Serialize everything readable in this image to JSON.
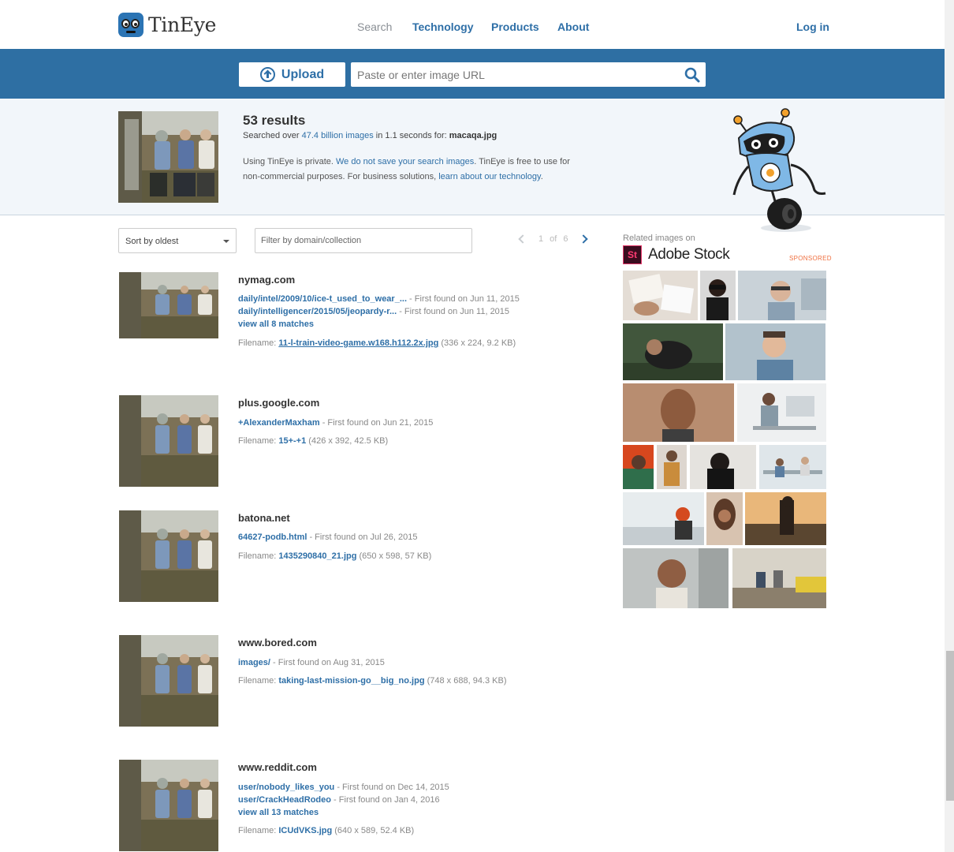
{
  "header": {
    "logo_text": "TinEye",
    "nav": {
      "search": "Search",
      "technology": "Technology",
      "products": "Products",
      "about": "About"
    },
    "login": "Log in"
  },
  "searchbar": {
    "upload_label": "Upload",
    "url_placeholder": "Paste or enter image URL"
  },
  "summary": {
    "results_count": "53 results",
    "searched_prefix": "Searched over ",
    "searched_link": "47.4 billion images",
    "searched_mid": " in 1.1 seconds for: ",
    "filename": "macaqa.jpg",
    "privacy_1": "Using TinEye is private. ",
    "privacy_link_1": "We do not save your search images",
    "privacy_2": ". TinEye is free to use for non-commercial purposes. For business solutions, ",
    "privacy_link_2": "learn about our technology",
    "privacy_3": "."
  },
  "filters": {
    "sort_value": "Sort by oldest",
    "filter_placeholder": "Filter by domain/collection",
    "page_current": "1",
    "page_of": "of",
    "page_total": "6"
  },
  "results": [
    {
      "domain": "nymag.com",
      "links": [
        {
          "path": "daily/intel/2009/10/ice-t_used_to_wear_...",
          "found": " - First found on Jun 11, 2015"
        },
        {
          "path": "daily/intelligencer/2015/05/jeopardy-r...",
          "found": " - First found on Jun 11, 2015"
        }
      ],
      "view_all": "view all 8 matches",
      "filename_label": "Filename: ",
      "filename": "11-l-train-video-game.w168.h112.2x.jpg",
      "file_info": " (336 x 224, 9.2 KB)"
    },
    {
      "domain": "plus.google.com",
      "links": [
        {
          "path": "+AlexanderMaxham",
          "found": " - First found on Jun 21, 2015"
        }
      ],
      "filename_label": "Filename: ",
      "filename": "15+-+1",
      "file_info": " (426 x 392, 42.5 KB)"
    },
    {
      "domain": "batona.net",
      "links": [
        {
          "path": "64627-podb.html",
          "found": " - First found on Jul 26, 2015"
        }
      ],
      "filename_label": "Filename: ",
      "filename": "1435290840_21.jpg",
      "file_info": " (650 x 598, 57 KB)"
    },
    {
      "domain": "www.bored.com",
      "links": [
        {
          "path": "images/",
          "found": " - First found on Aug 31, 2015"
        }
      ],
      "filename_label": "Filename: ",
      "filename": "taking-last-mission-go__big_no.jpg",
      "file_info": " (748 x 688, 94.3 KB)"
    },
    {
      "domain": "www.reddit.com",
      "links": [
        {
          "path": "user/nobody_likes_you",
          "found": " - First found on Dec 14, 2015"
        },
        {
          "path": "user/CrackHeadRodeo",
          "found": " - First found on Jan 4, 2016"
        }
      ],
      "view_all": "view all 13 matches",
      "filename_label": "Filename: ",
      "filename": "ICUdVKS.jpg",
      "file_info": " (640 x 589, 52.4 KB)"
    }
  ],
  "sidebar": {
    "related_label": "Related images on",
    "stock_badge": "St",
    "stock_name": "Adobe Stock",
    "sponsored": "SPONSORED"
  }
}
